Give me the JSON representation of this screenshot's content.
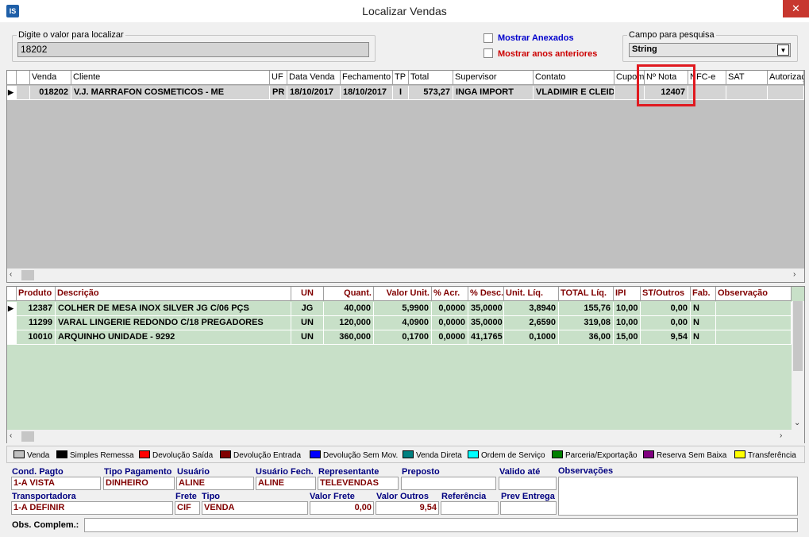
{
  "window": {
    "title": "Localizar Vendas",
    "icon_text": "IS",
    "close_glyph": "✕"
  },
  "search": {
    "group_label": "Digite o valor para localizar",
    "value": "18202"
  },
  "options": {
    "mostrar_anexados": "Mostrar Anexados",
    "mostrar_anos": "Mostrar anos anteriores",
    "anexados_color": "#0000cc",
    "anos_color": "#cc0000"
  },
  "campo": {
    "group_label": "Campo para pesquisa",
    "selected": "String"
  },
  "sales_grid": {
    "columns": [
      "Venda",
      "Cliente",
      "UF",
      "Data Venda",
      "Fechamento",
      "TP",
      "Total",
      "Supervisor",
      "Contato",
      "Cupom",
      "Nº Nota",
      "NFC-e",
      "SAT",
      "Autorizaç"
    ],
    "rows": [
      {
        "venda": "018202",
        "cliente": "V.J. MARRAFON COSMETICOS - ME",
        "uf": "PR",
        "data_venda": "18/10/2017",
        "fechamento": "18/10/2017",
        "tp": "I",
        "total": "573,27",
        "supervisor": "INGA IMPORT",
        "contato": "VLADIMIR E CLEIDI",
        "cupom": "",
        "nota": "12407",
        "nfce": "",
        "sat": "",
        "autoriz": ""
      }
    ],
    "highlight_color": "#e0191f"
  },
  "items_grid": {
    "columns": [
      "Produto",
      "Descrição",
      "UN",
      "Quant.",
      "Valor Unit.",
      "% Acr.",
      "% Desc.",
      "Unit. Líq.",
      "TOTAL Líq.",
      "IPI",
      "ST/Outros",
      "Fab.",
      "Observação"
    ],
    "rows": [
      {
        "produto": "12387",
        "descricao": "COLHER DE MESA INOX SILVER JG C/06 PÇS",
        "un": "JG",
        "quant": "40,000",
        "valor_unit": "5,9900",
        "acr": "0,0000",
        "desc": "35,0000",
        "unit_liq": "3,8940",
        "total_liq": "155,76",
        "ipi": "10,00",
        "st": "0,00",
        "fab": "N",
        "obs": ""
      },
      {
        "produto": "11299",
        "descricao": "VARAL LINGERIE REDONDO C/18 PREGADORES",
        "un": "UN",
        "quant": "120,000",
        "valor_unit": "4,0900",
        "acr": "0,0000",
        "desc": "35,0000",
        "unit_liq": "2,6590",
        "total_liq": "319,08",
        "ipi": "10,00",
        "st": "0,00",
        "fab": "N",
        "obs": ""
      },
      {
        "produto": "10010",
        "descricao": "ARQUINHO UNIDADE - 9292",
        "un": "UN",
        "quant": "360,000",
        "valor_unit": "0,1700",
        "acr": "0,0000",
        "desc": "41,1765",
        "unit_liq": "0,1000",
        "total_liq": "36,00",
        "ipi": "15,00",
        "st": "9,54",
        "fab": "N",
        "obs": ""
      }
    ]
  },
  "legend": [
    {
      "label": "Venda",
      "color": "#c0c0c0"
    },
    {
      "label": "Simples Remessa",
      "color": "#000000"
    },
    {
      "label": "Devolução Saída",
      "color": "#ff0000"
    },
    {
      "label": "Devolução Entrada",
      "color": "#800000"
    },
    {
      "label": "Devolução Sem Mov.",
      "color": "#0000ff"
    },
    {
      "label": "Venda Direta",
      "color": "#008080"
    },
    {
      "label": "Ordem de Serviço",
      "color": "#00ffff"
    },
    {
      "label": "Parceria/Exportação",
      "color": "#008000"
    },
    {
      "label": "Reserva Sem Baixa",
      "color": "#800080"
    },
    {
      "label": "Transferência",
      "color": "#ffff00"
    }
  ],
  "details": {
    "cond_pagto": {
      "label": "Cond. Pagto",
      "value": "1-A VISTA"
    },
    "tipo_pagamento": {
      "label": "Tipo Pagamento",
      "value": "DINHEIRO"
    },
    "usuario": {
      "label": "Usuário",
      "value": "ALINE"
    },
    "usuario_fech": {
      "label": "Usuário Fech.",
      "value": "ALINE"
    },
    "representante": {
      "label": "Representante",
      "value": "TELEVENDAS"
    },
    "preposto": {
      "label": "Preposto",
      "value": ""
    },
    "valido_ate": {
      "label": "Valido até",
      "value": ""
    },
    "observacoes": {
      "label": "Observações",
      "value": ""
    },
    "transportadora": {
      "label": "Transportadora",
      "value": "1-A DEFINIR"
    },
    "frete": {
      "label": "Frete",
      "value": "CIF"
    },
    "tipo": {
      "label": "Tipo",
      "value": "VENDA"
    },
    "valor_frete": {
      "label": "Valor Frete",
      "value": "0,00"
    },
    "valor_outros": {
      "label": "Valor Outros",
      "value": "9,54"
    },
    "referencia": {
      "label": "Referência",
      "value": ""
    },
    "prev_entrega": {
      "label": "Prev Entrega",
      "value": ""
    },
    "obs_complem": {
      "label": "Obs. Complem.:",
      "value": ""
    }
  }
}
